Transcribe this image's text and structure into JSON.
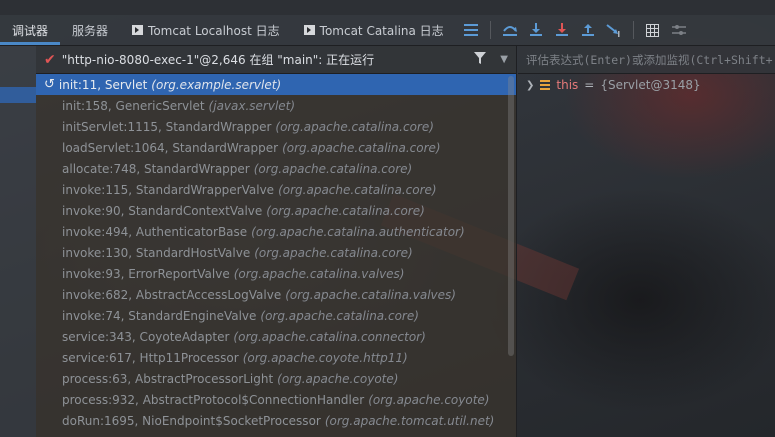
{
  "toolbar": {
    "tabs": [
      {
        "label": "调试器",
        "active": true
      },
      {
        "label": "服务器",
        "active": false
      },
      {
        "label": "Tomcat Localhost 日志",
        "active": false
      },
      {
        "label": "Tomcat Catalina 日志",
        "active": false
      }
    ],
    "icons": [
      "lines-icon",
      "step-over-icon",
      "step-into-icon",
      "force-step-into-icon",
      "step-out-icon",
      "run-to-cursor-icon",
      "evaluate-table-icon",
      "settings-icon"
    ]
  },
  "thread": {
    "label": "\"http-nio-8080-exec-1\"@2,646 在组 \"main\": 正在运行"
  },
  "frames": [
    {
      "method": "init:11, Servlet",
      "pkg": "(org.example.servlet)"
    },
    {
      "method": "init:158, GenericServlet",
      "pkg": "(javax.servlet)"
    },
    {
      "method": "initServlet:1115, StandardWrapper",
      "pkg": "(org.apache.catalina.core)"
    },
    {
      "method": "loadServlet:1064, StandardWrapper",
      "pkg": "(org.apache.catalina.core)"
    },
    {
      "method": "allocate:748, StandardWrapper",
      "pkg": "(org.apache.catalina.core)"
    },
    {
      "method": "invoke:115, StandardWrapperValve",
      "pkg": "(org.apache.catalina.core)"
    },
    {
      "method": "invoke:90, StandardContextValve",
      "pkg": "(org.apache.catalina.core)"
    },
    {
      "method": "invoke:494, AuthenticatorBase",
      "pkg": "(org.apache.catalina.authenticator)"
    },
    {
      "method": "invoke:130, StandardHostValve",
      "pkg": "(org.apache.catalina.core)"
    },
    {
      "method": "invoke:93, ErrorReportValve",
      "pkg": "(org.apache.catalina.valves)"
    },
    {
      "method": "invoke:682, AbstractAccessLogValve",
      "pkg": "(org.apache.catalina.valves)"
    },
    {
      "method": "invoke:74, StandardEngineValve",
      "pkg": "(org.apache.catalina.core)"
    },
    {
      "method": "service:343, CoyoteAdapter",
      "pkg": "(org.apache.catalina.connector)"
    },
    {
      "method": "service:617, Http11Processor",
      "pkg": "(org.apache.coyote.http11)"
    },
    {
      "method": "process:63, AbstractProcessorLight",
      "pkg": "(org.apache.coyote)"
    },
    {
      "method": "process:932, AbstractProtocol$ConnectionHandler",
      "pkg": "(org.apache.coyote)"
    },
    {
      "method": "doRun:1695, NioEndpoint$SocketProcessor",
      "pkg": "(org.apache.tomcat.util.net)"
    }
  ],
  "watches": {
    "placeholder": "评估表达式(Enter)或添加监视(Ctrl+Shift+",
    "variables": [
      {
        "name": "this",
        "eq": "=",
        "value": "{Servlet@3148}"
      }
    ]
  },
  "colors": {
    "selection": "#2f65b1",
    "accent_tab": "#4a88c7",
    "variable_name": "#e57a7a"
  }
}
